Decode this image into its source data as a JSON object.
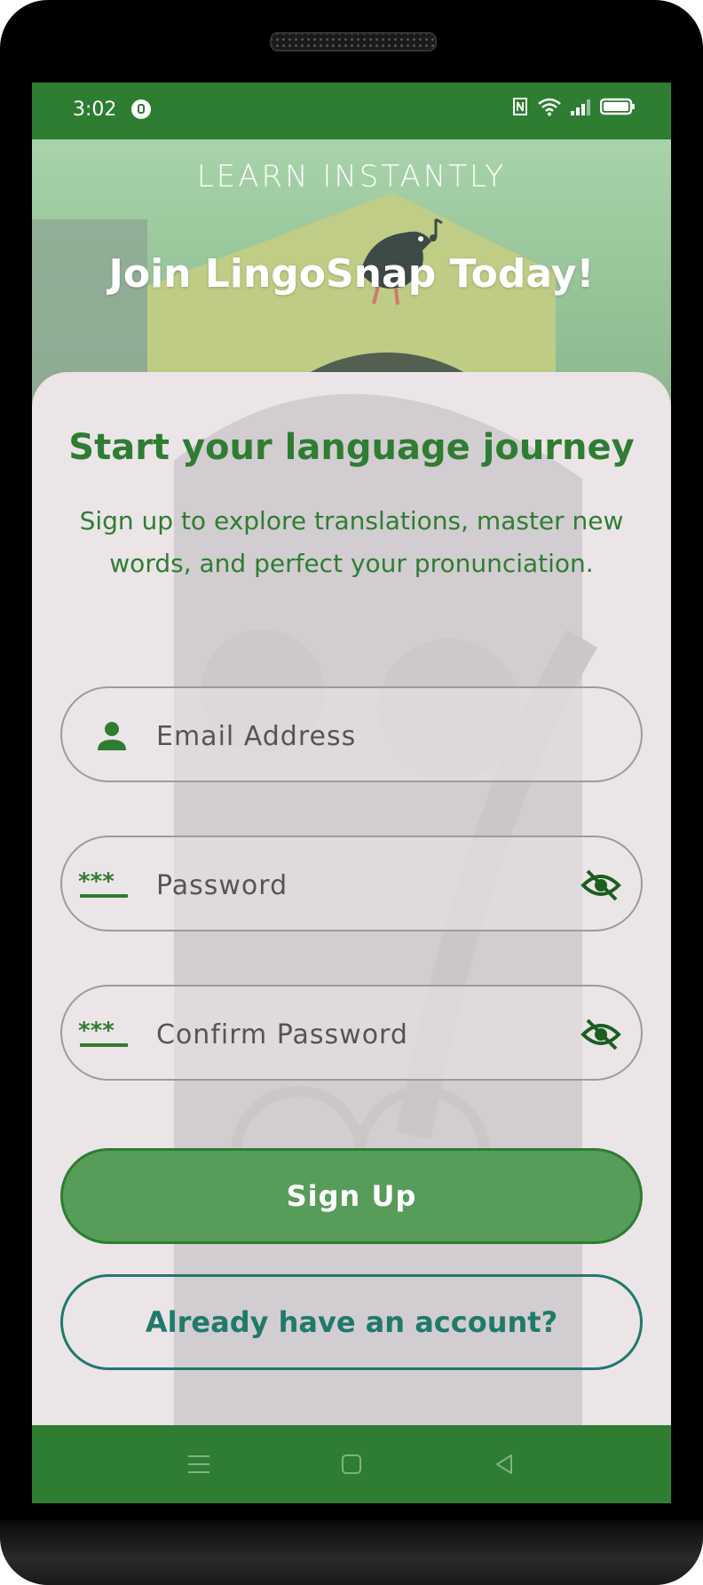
{
  "status_bar": {
    "time": "3:02",
    "icons": [
      "vpn-lock-icon",
      "nfc-icon",
      "wifi-icon",
      "signal-icon",
      "battery-icon"
    ]
  },
  "hero": {
    "tagline": "LEARN INSTANTLY",
    "title": "Join LingoSnap Today!"
  },
  "card": {
    "title": "Start your language journey",
    "subtitle": "Sign up to explore translations, master new words, and perfect your pronunciation."
  },
  "form": {
    "email": {
      "placeholder": "Email Address",
      "value": "",
      "icon": "person-icon"
    },
    "password": {
      "placeholder": "Password",
      "value": "",
      "icon": "password-icon",
      "toggle_icon": "eye-off-icon"
    },
    "confirm_password": {
      "placeholder": "Confirm Password",
      "value": "",
      "icon": "password-icon",
      "toggle_icon": "eye-off-icon"
    }
  },
  "buttons": {
    "signup_label": "Sign Up",
    "login_label": "Already have an account?"
  },
  "nav": {
    "items": [
      "menu-icon",
      "home-icon",
      "back-icon"
    ]
  },
  "colors": {
    "primary": "#2e7d32",
    "primary_button_fill": "#579c59",
    "secondary_outline": "#1f7a6a",
    "card_background": "#ebe5e8"
  }
}
